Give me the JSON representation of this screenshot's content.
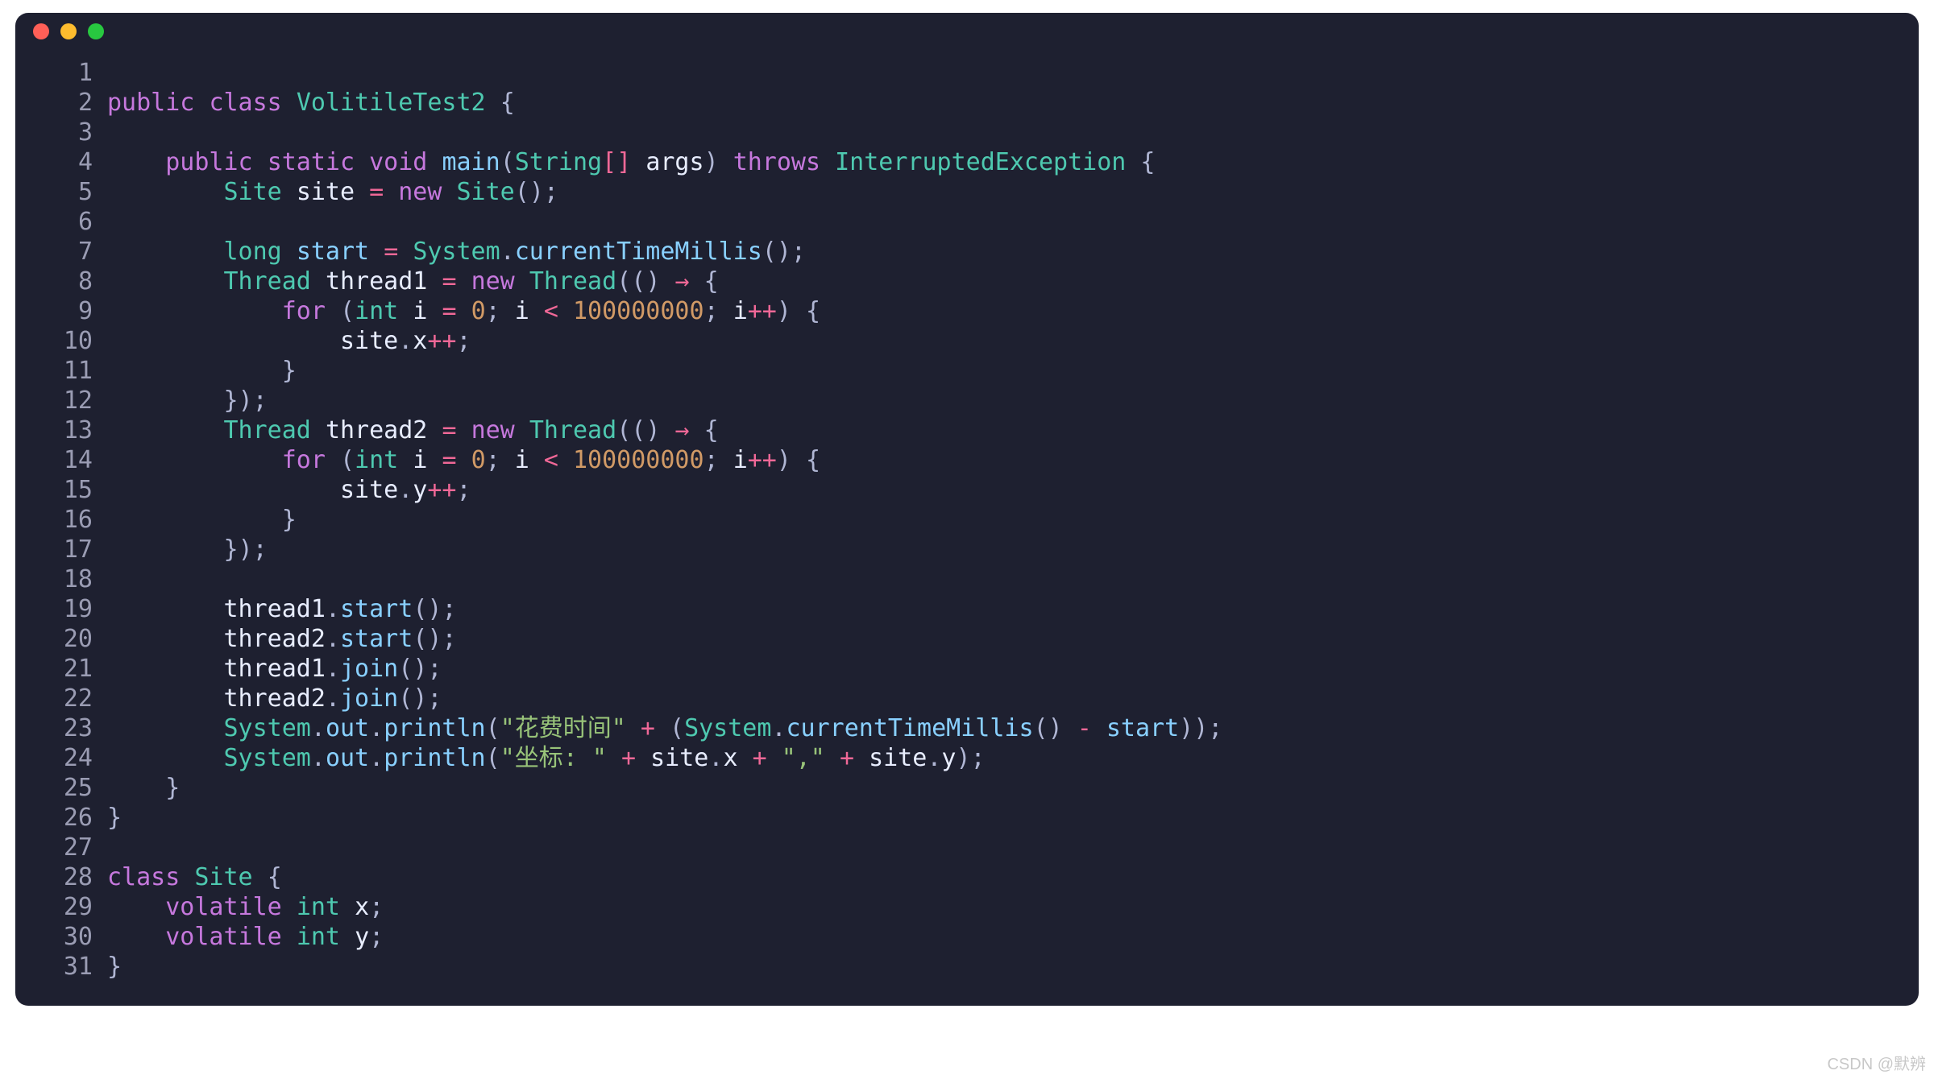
{
  "window": {
    "traffic_lights": [
      "close",
      "minimize",
      "zoom"
    ]
  },
  "watermark": "CSDN @默辨",
  "code": {
    "language": "java",
    "lines": [
      {
        "n": 1,
        "text": ""
      },
      {
        "n": 2,
        "text": "public class VolitileTest2 {"
      },
      {
        "n": 3,
        "text": ""
      },
      {
        "n": 4,
        "text": "    public static void main(String[] args) throws InterruptedException {"
      },
      {
        "n": 5,
        "text": "        Site site = new Site();"
      },
      {
        "n": 6,
        "text": ""
      },
      {
        "n": 7,
        "text": "        long start = System.currentTimeMillis();"
      },
      {
        "n": 8,
        "text": "        Thread thread1 = new Thread(() → {"
      },
      {
        "n": 9,
        "text": "            for (int i = 0; i < 100000000; i++) {"
      },
      {
        "n": 10,
        "text": "                site.x++;"
      },
      {
        "n": 11,
        "text": "            }"
      },
      {
        "n": 12,
        "text": "        });"
      },
      {
        "n": 13,
        "text": "        Thread thread2 = new Thread(() → {"
      },
      {
        "n": 14,
        "text": "            for (int i = 0; i < 100000000; i++) {"
      },
      {
        "n": 15,
        "text": "                site.y++;"
      },
      {
        "n": 16,
        "text": "            }"
      },
      {
        "n": 17,
        "text": "        });"
      },
      {
        "n": 18,
        "text": ""
      },
      {
        "n": 19,
        "text": "        thread1.start();"
      },
      {
        "n": 20,
        "text": "        thread2.start();"
      },
      {
        "n": 21,
        "text": "        thread1.join();"
      },
      {
        "n": 22,
        "text": "        thread2.join();"
      },
      {
        "n": 23,
        "text": "        System.out.println(\"花费时间\" + (System.currentTimeMillis() - start));"
      },
      {
        "n": 24,
        "text": "        System.out.println(\"坐标: \" + site.x + \",\" + site.y);"
      },
      {
        "n": 25,
        "text": "    }"
      },
      {
        "n": 26,
        "text": "}"
      },
      {
        "n": 27,
        "text": ""
      },
      {
        "n": 28,
        "text": "class Site {"
      },
      {
        "n": 29,
        "text": "    volatile int x;"
      },
      {
        "n": 30,
        "text": "    volatile int y;"
      },
      {
        "n": 31,
        "text": "}"
      }
    ]
  },
  "tokens": {
    "keywords_pink": [
      "public",
      "class",
      "static",
      "void",
      "throws",
      "new",
      "for",
      "volatile"
    ],
    "types_cyan": [
      "VolitileTest2",
      "String",
      "InterruptedException",
      "Site",
      "long",
      "System",
      "Thread",
      "int"
    ],
    "functions_blue": [
      "main",
      "currentTimeMillis",
      "start",
      "join",
      "println",
      "out"
    ],
    "numbers": [
      "0",
      "100000000"
    ],
    "strings": [
      "\"花费时间\"",
      "\"坐标: \"",
      "\",\""
    ],
    "operators_pink": [
      "++",
      "→",
      "<",
      "-",
      "+",
      "="
    ]
  }
}
